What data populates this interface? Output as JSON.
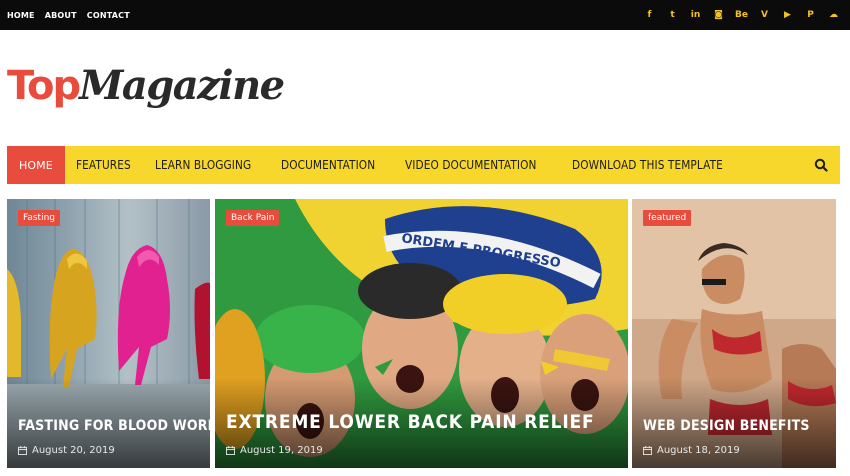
{
  "topbar": {
    "links": [
      "HOME",
      "ABOUT",
      "CONTACT"
    ],
    "social_icons": [
      "facebook-icon",
      "twitter-icon",
      "linkedin-icon",
      "instagram-icon",
      "behance-icon",
      "vimeo-icon",
      "youtube-icon",
      "pinterest-icon",
      "soundcloud-icon"
    ],
    "social_glyphs": [
      "f",
      "t",
      "in",
      "◙",
      "Be",
      "V",
      "▶",
      "P",
      "☁"
    ],
    "accent": "#f4c21c"
  },
  "logo": {
    "part1": "Top",
    "part2": "Magazine"
  },
  "nav": {
    "items": [
      "HOME",
      "FEATURES",
      "LEARN BLOGGING",
      "DOCUMENTATION",
      "VIDEO DOCUMENTATION",
      "DOWNLOAD THIS TEMPLATE"
    ],
    "active_index": 0,
    "bg": "#f7d72b",
    "active_bg": "#e74c3c"
  },
  "cards": [
    {
      "badge": "Fasting",
      "title": "FASTING FOR BLOOD WORK",
      "date": "August 20, 2019"
    },
    {
      "badge": "Back Pain",
      "title": "EXTREME LOWER BACK PAIN RELIEF",
      "date": "August 19, 2019"
    },
    {
      "badge": "featured",
      "title": "WEB DESIGN BENEFITS",
      "date": "August 18, 2019"
    }
  ],
  "crowd_flag_text": "ORDEM E PROGRESSO"
}
